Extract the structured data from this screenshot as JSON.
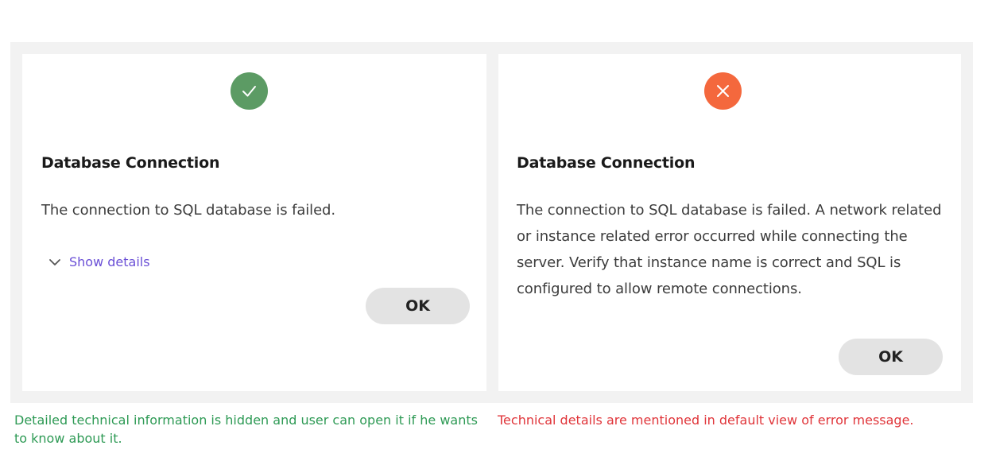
{
  "success_dialog": {
    "status_icon": "checkmark-icon",
    "icon_color": "#5c9b64",
    "title": "Database Connection",
    "message": "The connection to SQL database is failed.",
    "show_details_label": "Show details",
    "ok_label": "OK"
  },
  "error_dialog": {
    "status_icon": "close-icon",
    "icon_color": "#f4683d",
    "title": "Database Connection",
    "message": "The connection to SQL database is failed. A network related or instance related error occurred while connecting the server. Verify that instance name is correct and SQL is configured to allow remote connections.",
    "ok_label": "OK"
  },
  "captions": {
    "left": "Detailed technical information is hidden and user can open it if he wants to know about it.",
    "left_color": "#2e9a55",
    "right": "Technical details are mentioned in default view of error message.",
    "right_color": "#e0353a"
  },
  "colors": {
    "link": "#6a4fd6",
    "frame_background": "#f2f2f2",
    "button_background": "#e3e3e3"
  }
}
